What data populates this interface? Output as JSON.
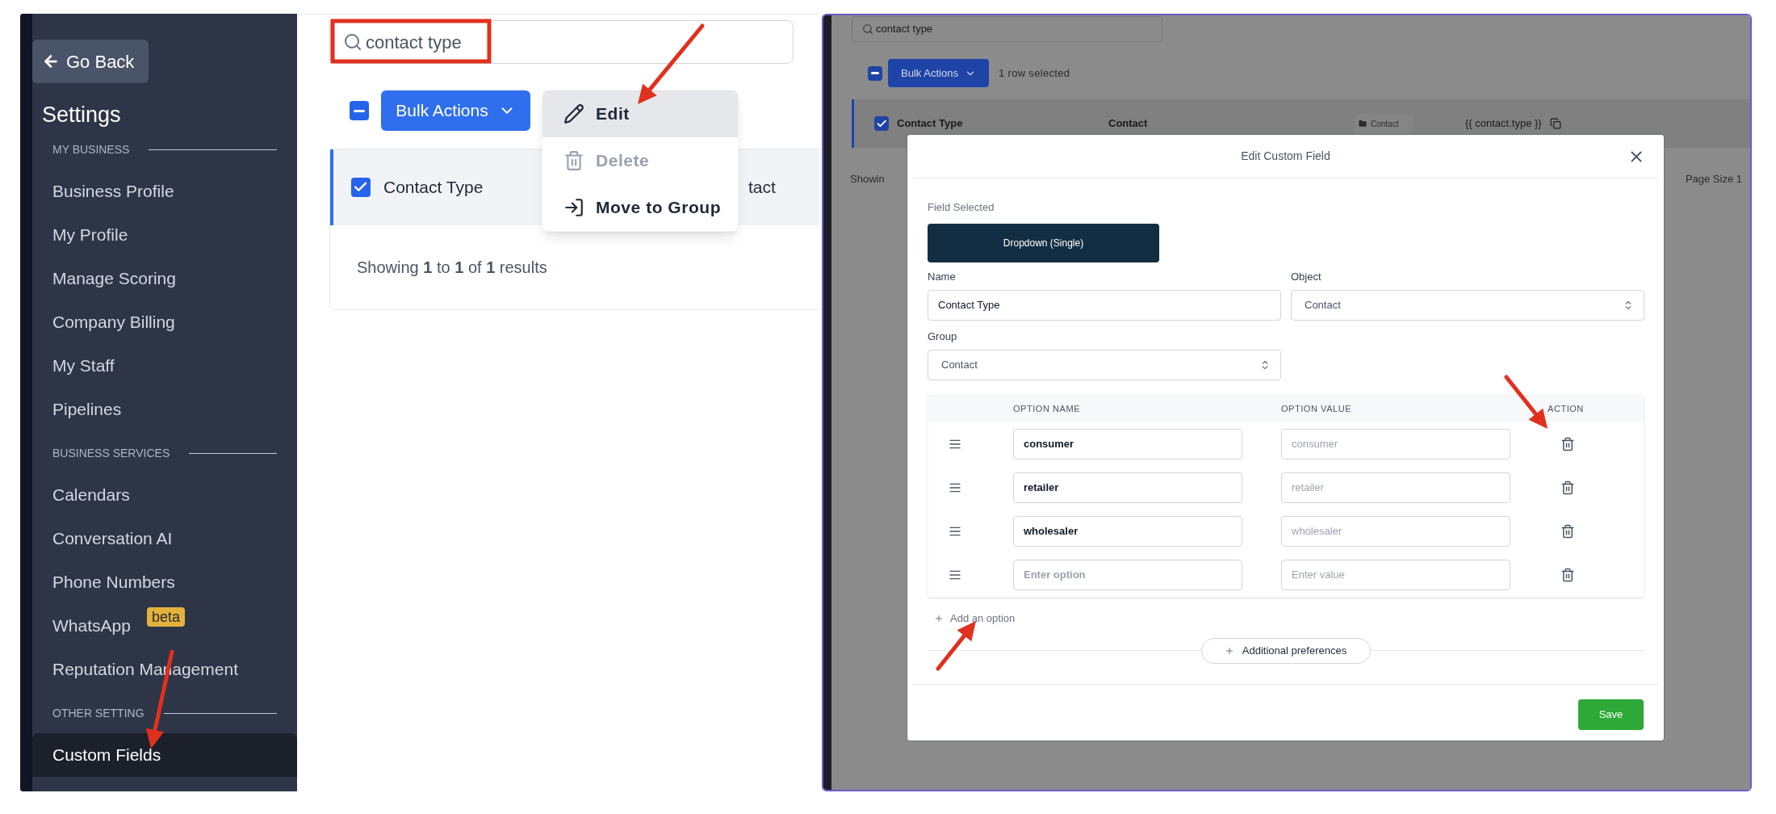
{
  "sidebar": {
    "back_button": "Go Back",
    "title": "Settings",
    "sections": [
      {
        "heading": "MY BUSINESS",
        "items": [
          {
            "label": "Business Profile",
            "selected": false
          },
          {
            "label": "My Profile",
            "selected": false
          },
          {
            "label": "Manage Scoring",
            "selected": false
          },
          {
            "label": "Company Billing",
            "selected": false
          },
          {
            "label": "My Staff",
            "selected": false
          },
          {
            "label": "Pipelines",
            "selected": false
          }
        ]
      },
      {
        "heading": "BUSINESS SERVICES",
        "items": [
          {
            "label": "Calendars",
            "selected": false
          },
          {
            "label": "Conversation AI",
            "selected": false
          },
          {
            "label": "Phone Numbers",
            "selected": false
          },
          {
            "label": "WhatsApp",
            "badge": "beta",
            "selected": false
          },
          {
            "label": "Reputation Management",
            "selected": false
          }
        ]
      },
      {
        "heading": "OTHER SETTING",
        "items": [
          {
            "label": "Custom Fields",
            "selected": true
          }
        ]
      }
    ]
  },
  "list_view": {
    "search": {
      "value": "contact type"
    },
    "select_all": {
      "indeterminate": true
    },
    "bulk_actions": "Bulk Actions",
    "menu": [
      {
        "kind": "edit",
        "label": "Edit",
        "highlighted": true,
        "disabled": false
      },
      {
        "kind": "delete",
        "label": "Delete",
        "highlighted": false,
        "disabled": true
      },
      {
        "kind": "move",
        "label": "Move to Group",
        "highlighted": false,
        "disabled": false
      }
    ],
    "row": {
      "checked": true,
      "name": "Contact Type",
      "column_2": "tact"
    },
    "footer": "Showing **1** to **1** of **1** results"
  },
  "background_view": {
    "search": {
      "value": "contact type"
    },
    "select_all": {
      "indeterminate": true
    },
    "bulk_actions": "Bulk Actions",
    "selection_info": "1 row selected",
    "row": {
      "checked": true,
      "name": "Contact Type",
      "object": "Contact",
      "group": "Contact",
      "key": "{{ contact.type }}"
    },
    "footer_left": "Showin",
    "footer_right": "Page Size 1"
  },
  "modal": {
    "title": "Edit Custom Field",
    "field_selected_label": "Field Selected",
    "field_type": "Dropdown (Single)",
    "name": {
      "label": "Name",
      "value": "Contact Type"
    },
    "object": {
      "label": "Object",
      "value": "Contact"
    },
    "group": {
      "label": "Group",
      "value": "Contact"
    },
    "options_table": {
      "columns": [
        "OPTION NAME",
        "OPTION VALUE",
        "ACTION"
      ],
      "rows": [
        {
          "name": {
            "value": "consumer"
          },
          "value": {
            "placeholder": "consumer"
          }
        },
        {
          "name": {
            "value": "retailer"
          },
          "value": {
            "placeholder": "retailer"
          }
        },
        {
          "name": {
            "value": "wholesaler"
          },
          "value": {
            "placeholder": "wholesaler"
          }
        },
        {
          "name": {
            "placeholder": "Enter option"
          },
          "value": {
            "placeholder": "Enter value"
          }
        }
      ]
    },
    "add_option": "Add an option",
    "additional_preferences": "Additional preferences",
    "save": "Save"
  }
}
